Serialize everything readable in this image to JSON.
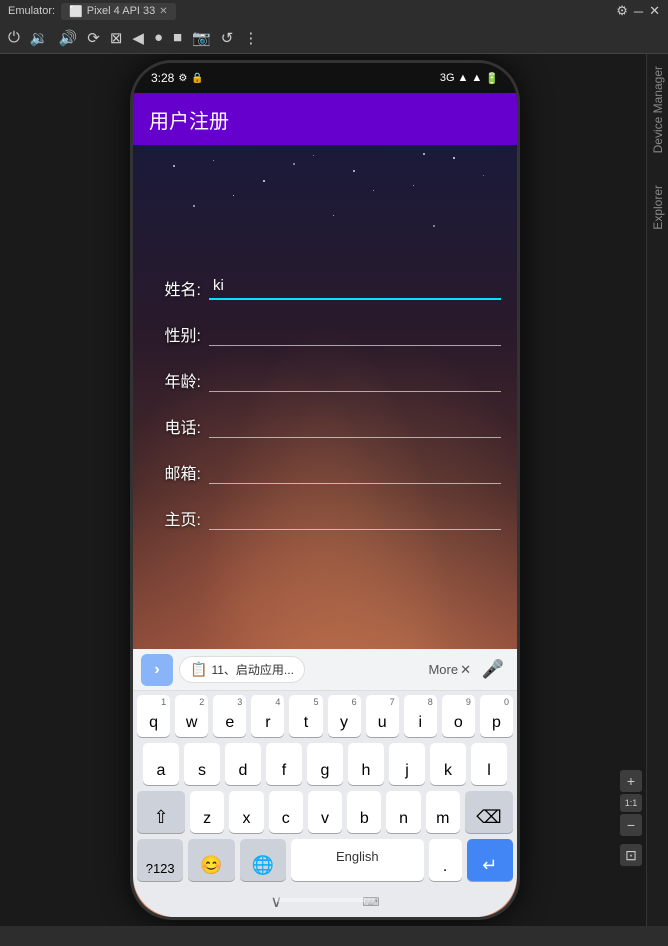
{
  "toolbar": {
    "emulator_label": "Emulator:",
    "tab_label": "Pixel 4 API 33",
    "gear_icon": "⚙",
    "settings_icon": "⚙",
    "close_icon": "✕",
    "power_icon": "⏻",
    "volume_down_icon": "🔉",
    "volume_up_icon": "🔊",
    "rotate_icon": "⟳",
    "fold_icon": "⊠",
    "back_icon": "◀",
    "home_circle": "●",
    "square_icon": "■",
    "camera_icon": "📷",
    "undo_icon": "↺",
    "more_icon": "⋮"
  },
  "status_bar": {
    "time": "3:28",
    "settings_icon": "⚙",
    "lock_icon": "🔒",
    "signal_icon": "3G",
    "wifi_icon": "▲",
    "battery_icon": "🔋"
  },
  "app_bar": {
    "title": "用户注册"
  },
  "form": {
    "name_label": "姓名:",
    "name_value": "ki",
    "gender_label": "性别:",
    "gender_value": "",
    "age_label": "年龄:",
    "age_value": "",
    "phone_label": "电话:",
    "phone_value": "",
    "email_label": "邮箱:",
    "email_value": "",
    "homepage_label": "主页:",
    "homepage_value": ""
  },
  "keyboard": {
    "suggest_arrow": "›",
    "suggest_text": "11、启动应用...",
    "suggest_more": "More",
    "suggest_more_icon": "✕",
    "rows": [
      [
        "q",
        "w",
        "e",
        "r",
        "t",
        "y",
        "u",
        "i",
        "o",
        "p"
      ],
      [
        "a",
        "s",
        "d",
        "f",
        "g",
        "h",
        "j",
        "k",
        "l"
      ],
      [
        "z",
        "x",
        "c",
        "v",
        "b",
        "n",
        "m"
      ]
    ],
    "nums": [
      [
        "1",
        "2",
        "3",
        "4",
        "5",
        "6",
        "7",
        "8",
        "9",
        "0"
      ],
      [
        "",
        "",
        "",
        "",
        "",
        "",
        "",
        "",
        ""
      ],
      [
        "",
        "",
        "",
        "",
        "",
        "",
        ""
      ]
    ],
    "shift_icon": "⇧",
    "delete_icon": "⌫",
    "num_switch": "?123",
    "emoji_icon": "😊",
    "globe_icon": "🌐",
    "space_label": "English",
    "period": ".",
    "enter_icon": "↵",
    "mic_icon": "🎤"
  },
  "zoom": {
    "plus": "+",
    "minus": "−",
    "ratio": "1:1",
    "snap": "⊡"
  },
  "right_panel": {
    "device_manager": "Device Manager",
    "explorer": "Explorer"
  }
}
